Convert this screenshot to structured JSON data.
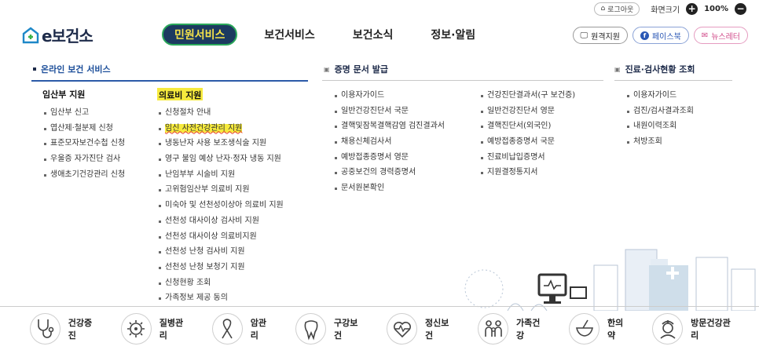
{
  "util": {
    "logout": "로그아웃",
    "zoom_label": "화면크기",
    "zoom_value": "100%"
  },
  "logo": {
    "text": "e보건소"
  },
  "gnb": [
    "민원서비스",
    "보건서비스",
    "보건소식",
    "정보·알림"
  ],
  "header_buttons": {
    "remote": "원격지원",
    "facebook": "페이스북",
    "newsletter": "뉴스레터"
  },
  "sections": {
    "online": "온라인 보건 서비스",
    "cert": "증명 문서 발급",
    "exam": "진료·검사현황 조회"
  },
  "col_pregnant": {
    "title": "임산부 지원",
    "items": [
      "임산부 신고",
      "엽산제·철분제 신청",
      "표준모자보건수첩 신청",
      "우울증 자가진단 검사",
      "생애초기건강관리 신청"
    ]
  },
  "col_medical": {
    "title": "의료비 지원",
    "items": [
      "신청절차 안내",
      "임신 사전건강관리 지원",
      "냉동난자 사용 보조생식술 지원",
      "영구 불임 예상 난자·정자 냉동 지원",
      "난임부부 시술비 지원",
      "고위험임산부 의료비 지원",
      "미숙아 및 선천성이상아 의료비 지원",
      "선천성 대사이상 검사비 지원",
      "선천성 대사이상 의료비지원",
      "선천성 난청 검사비 지원",
      "선천성 난청 보청기 지원",
      "신청현황 조회",
      "가족정보 제공 동의"
    ]
  },
  "col_cert1": {
    "items": [
      "이용자가이드",
      "일반건강진단서 국문",
      "결핵및잠복결핵감염 검진결과서",
      "채용신체검사서",
      "예방접종증명서 영문",
      "공중보건의 경력증명서",
      "문서원본확인"
    ]
  },
  "col_cert2": {
    "items": [
      "건강진단결과서(구 보건증)",
      "일반건강진단서 영문",
      "결핵진단서(외국인)",
      "예방접종증명서 국문",
      "진료비납입증명서",
      "지원결정통지서"
    ]
  },
  "col_exam": {
    "items": [
      "이용자가이드",
      "검진/검사결과조회",
      "내원이력조회",
      "처방조회"
    ]
  },
  "categories": [
    {
      "label": "건강증진",
      "icon": "stethoscope-icon"
    },
    {
      "label": "질병관리",
      "icon": "virus-icon"
    },
    {
      "label": "암관리",
      "icon": "ribbon-icon"
    },
    {
      "label": "구강보건",
      "icon": "tooth-icon"
    },
    {
      "label": "정신보건",
      "icon": "heart-pulse-icon"
    },
    {
      "label": "가족건강",
      "icon": "family-icon"
    },
    {
      "label": "한의약",
      "icon": "mortar-icon"
    },
    {
      "label": "방문건강관리",
      "icon": "nurse-icon"
    }
  ],
  "colors": {
    "navy": "#1c3a60",
    "highlight": "#f6ea3d",
    "accent_blue": "#2c5aa8"
  }
}
